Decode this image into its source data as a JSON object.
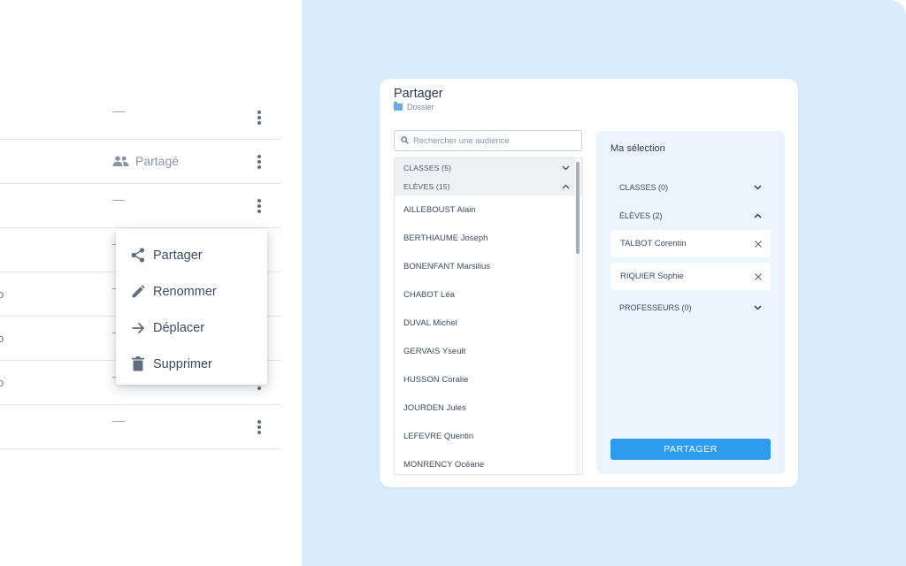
{
  "file_list": {
    "rows": [
      {
        "partial": "",
        "status": "—",
        "shared": false
      },
      {
        "partial": "",
        "status": "Partagé",
        "shared": true
      },
      {
        "partial": "",
        "status": "—",
        "shared": false
      },
      {
        "partial": "",
        "status": "—",
        "shared": false
      },
      {
        "partial": "o",
        "status": "—",
        "shared": false
      },
      {
        "partial": "o",
        "status": "—",
        "shared": false
      },
      {
        "partial": "o",
        "status": "—",
        "shared": false
      },
      {
        "partial": "",
        "status": "—",
        "shared": false
      }
    ]
  },
  "context_menu": {
    "items": [
      {
        "label": "Partager",
        "icon": "share-icon"
      },
      {
        "label": "Renommer",
        "icon": "pencil-icon"
      },
      {
        "label": "Déplacer",
        "icon": "arrow-right-icon"
      },
      {
        "label": "Supprimer",
        "icon": "trash-icon"
      }
    ]
  },
  "dialog": {
    "title": "Partager",
    "subtitle": "Dossier",
    "search_placeholder": "Rechercher une audience",
    "groups": {
      "classes": "CLASSES (5)",
      "eleves": "ELÈVES (15)"
    },
    "students": [
      "AILLEBOUST Alain",
      "BERTHIAUME Joseph",
      "BONENFANT Marsilius",
      "CHABOT Léa",
      "DUVAL Michel",
      "GERVAIS Yseult",
      "HUSSON Coralie",
      "JOURDEN Jules",
      "LEFEVRE Quentin",
      "MONRENCY Océane"
    ],
    "selection": {
      "title": "Ma sélection",
      "classes_label": "CLASSES (0)",
      "eleves_label": "ÉLÈVES (2)",
      "selected": [
        "TALBOT Corentin",
        "RIQUIER Sophie"
      ],
      "professeurs_label": "PROFESSEURS (0)",
      "share_button": "PARTAGER"
    }
  },
  "colors": {
    "accent": "#2f9bef",
    "backdrop": "#d9ecfb",
    "selection_panel": "#ecf5fd"
  }
}
